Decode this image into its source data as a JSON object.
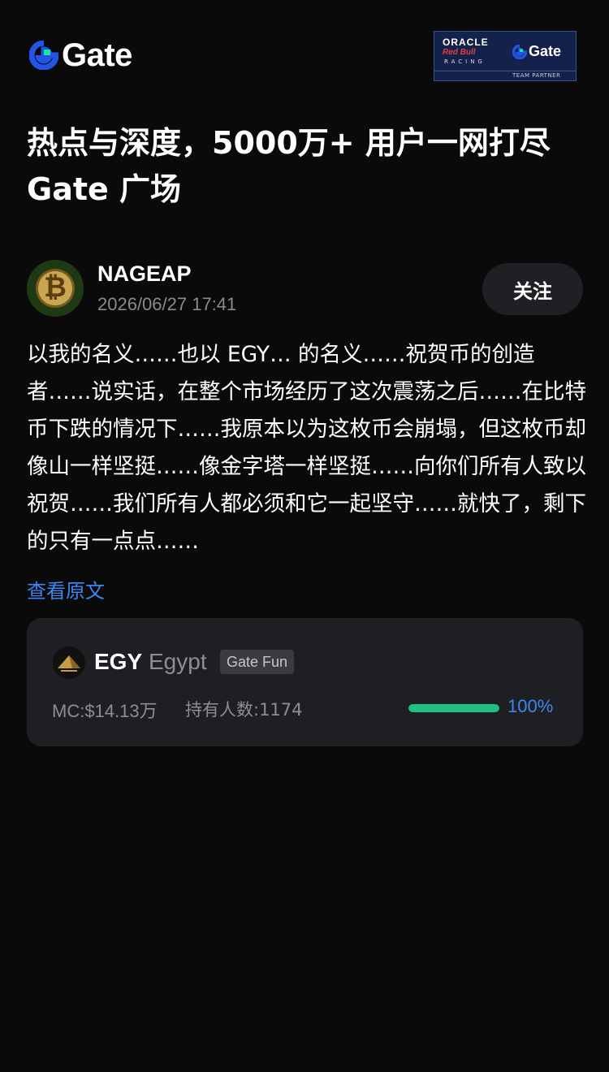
{
  "brand": {
    "name": "Gate",
    "accent": "#2354e6",
    "accent_secondary": "#17e8a3"
  },
  "partner_banner": {
    "line1": "ORACLE",
    "line2": "Red Bull",
    "line3": "RACING",
    "brand": "Gate",
    "caption": "TEAM PARTNER"
  },
  "headline": {
    "line1": "热点与深度，5000万+ 用户一网打尽",
    "line2": "Gate 广场"
  },
  "post": {
    "author": "NAGEAP",
    "timestamp": "2026/06/27 17:41",
    "follow_label": "关注",
    "body": "以我的名义……也以 EGY… 的名义……祝贺币的创造者……说实话，在整个市场经历了这次震荡之后……在比特币下跌的情况下……我原本以为这枚币会崩塌，但这枚币却像山一样坚挺……像金字塔一样坚挺……向你们所有人致以祝贺……我们所有人都必须和它一起坚守……就快了，剩下的只有一点点……",
    "view_original_label": "查看原文"
  },
  "token": {
    "symbol": "EGY",
    "name": "Egypt",
    "tag": "Gate Fun",
    "market_cap": "MC:$14.13万",
    "holders": "持有人数:1174",
    "progress_label": "100%",
    "progress_fraction": 1.0,
    "progress_color": "#1fbf84"
  }
}
